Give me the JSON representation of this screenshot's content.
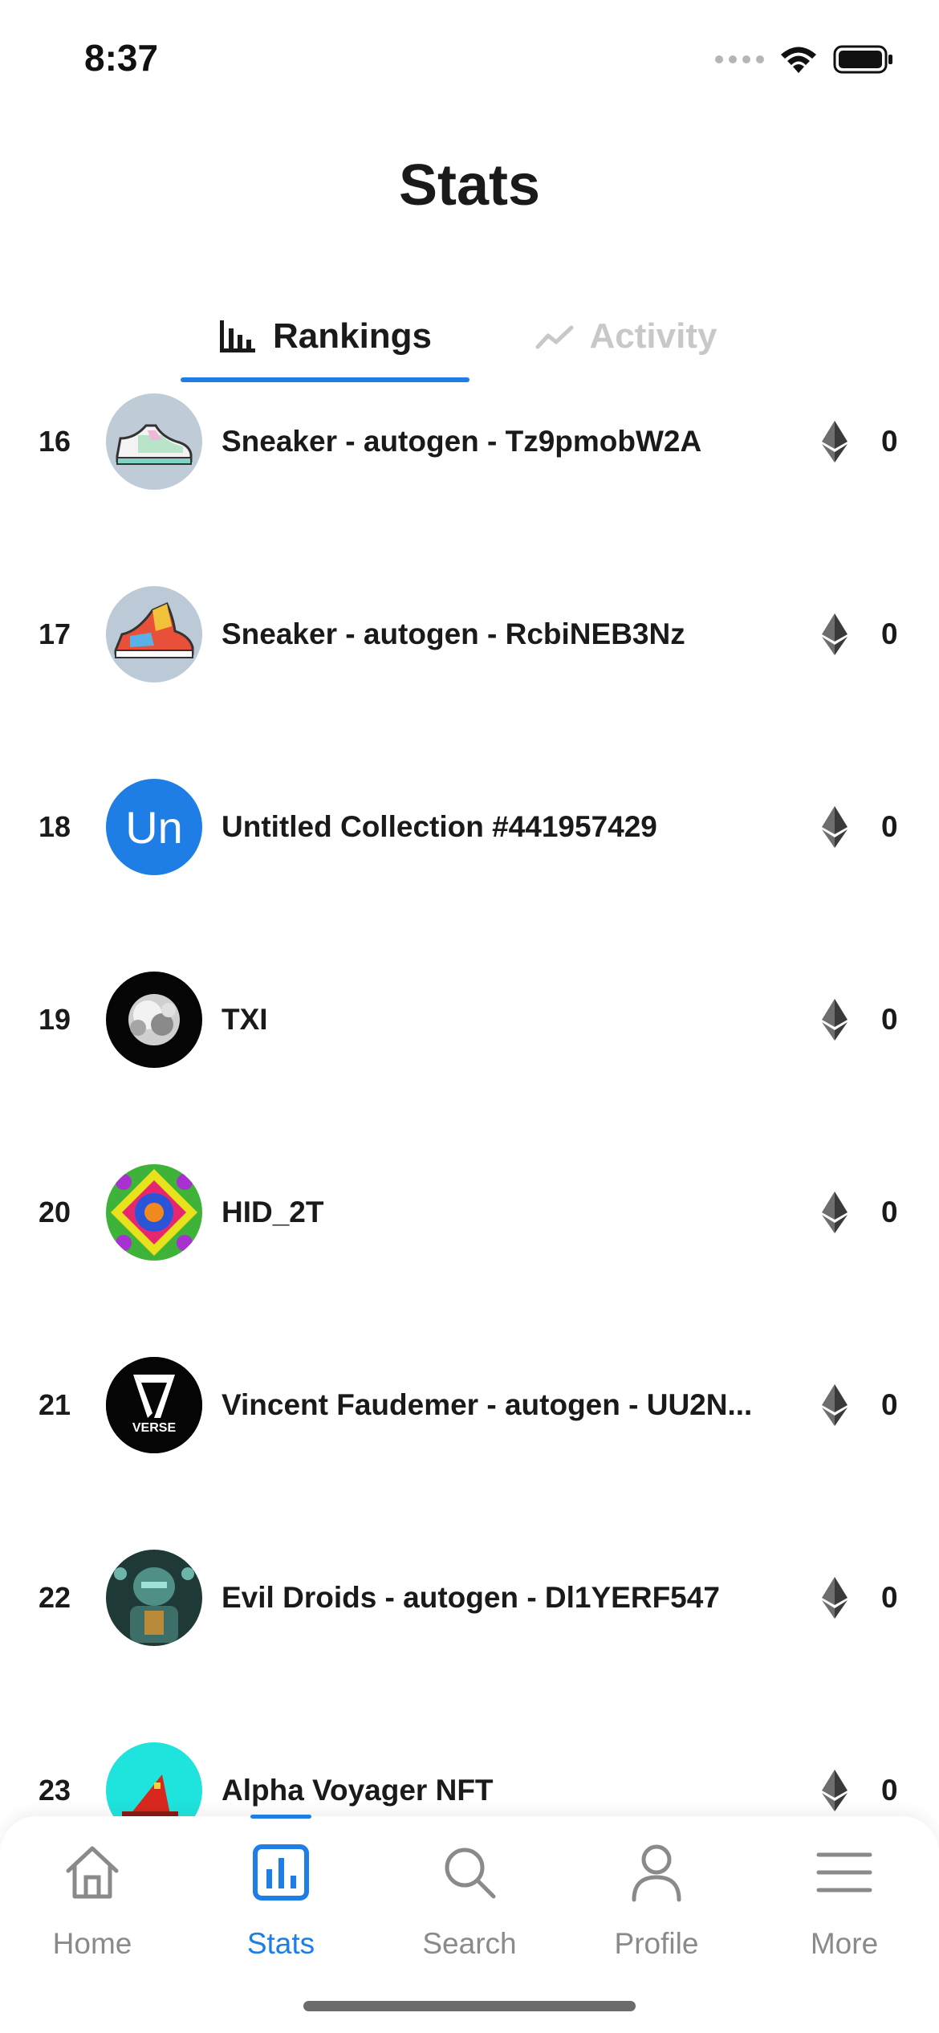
{
  "status_bar": {
    "time": "8:37"
  },
  "header": {
    "title": "Stats"
  },
  "tabs": [
    {
      "label": "Rankings",
      "active": true
    },
    {
      "label": "Activity",
      "active": false
    }
  ],
  "rows": [
    {
      "rank": "16",
      "name": "Sneaker - autogen - Tz9pmobW2A",
      "value": "0"
    },
    {
      "rank": "17",
      "name": "Sneaker - autogen - RcbiNEB3Nz",
      "value": "0"
    },
    {
      "rank": "18",
      "name": "Untitled Collection #441957429",
      "value": "0",
      "avatar_text": "Un"
    },
    {
      "rank": "19",
      "name": "TXI",
      "value": "0"
    },
    {
      "rank": "20",
      "name": "HID_2T",
      "value": "0"
    },
    {
      "rank": "21",
      "name": "Vincent Faudemer - autogen - UU2N...",
      "value": "0",
      "avatar_text": "VERSE"
    },
    {
      "rank": "22",
      "name": "Evil Droids - autogen - Dl1YERF547",
      "value": "0"
    },
    {
      "rank": "23",
      "name": "Alpha Voyager NFT",
      "value": "0"
    }
  ],
  "bottom_nav": [
    {
      "label": "Home",
      "icon": "home-icon",
      "active": false
    },
    {
      "label": "Stats",
      "icon": "stats-icon",
      "active": true
    },
    {
      "label": "Search",
      "icon": "search-icon",
      "active": false
    },
    {
      "label": "Profile",
      "icon": "profile-icon",
      "active": false
    },
    {
      "label": "More",
      "icon": "menu-icon",
      "active": false
    }
  ],
  "colors": {
    "accent": "#1e7ee6",
    "text": "#1a1a1a",
    "muted": "#8a8a8a",
    "tab_inactive": "#c8c8c8"
  }
}
